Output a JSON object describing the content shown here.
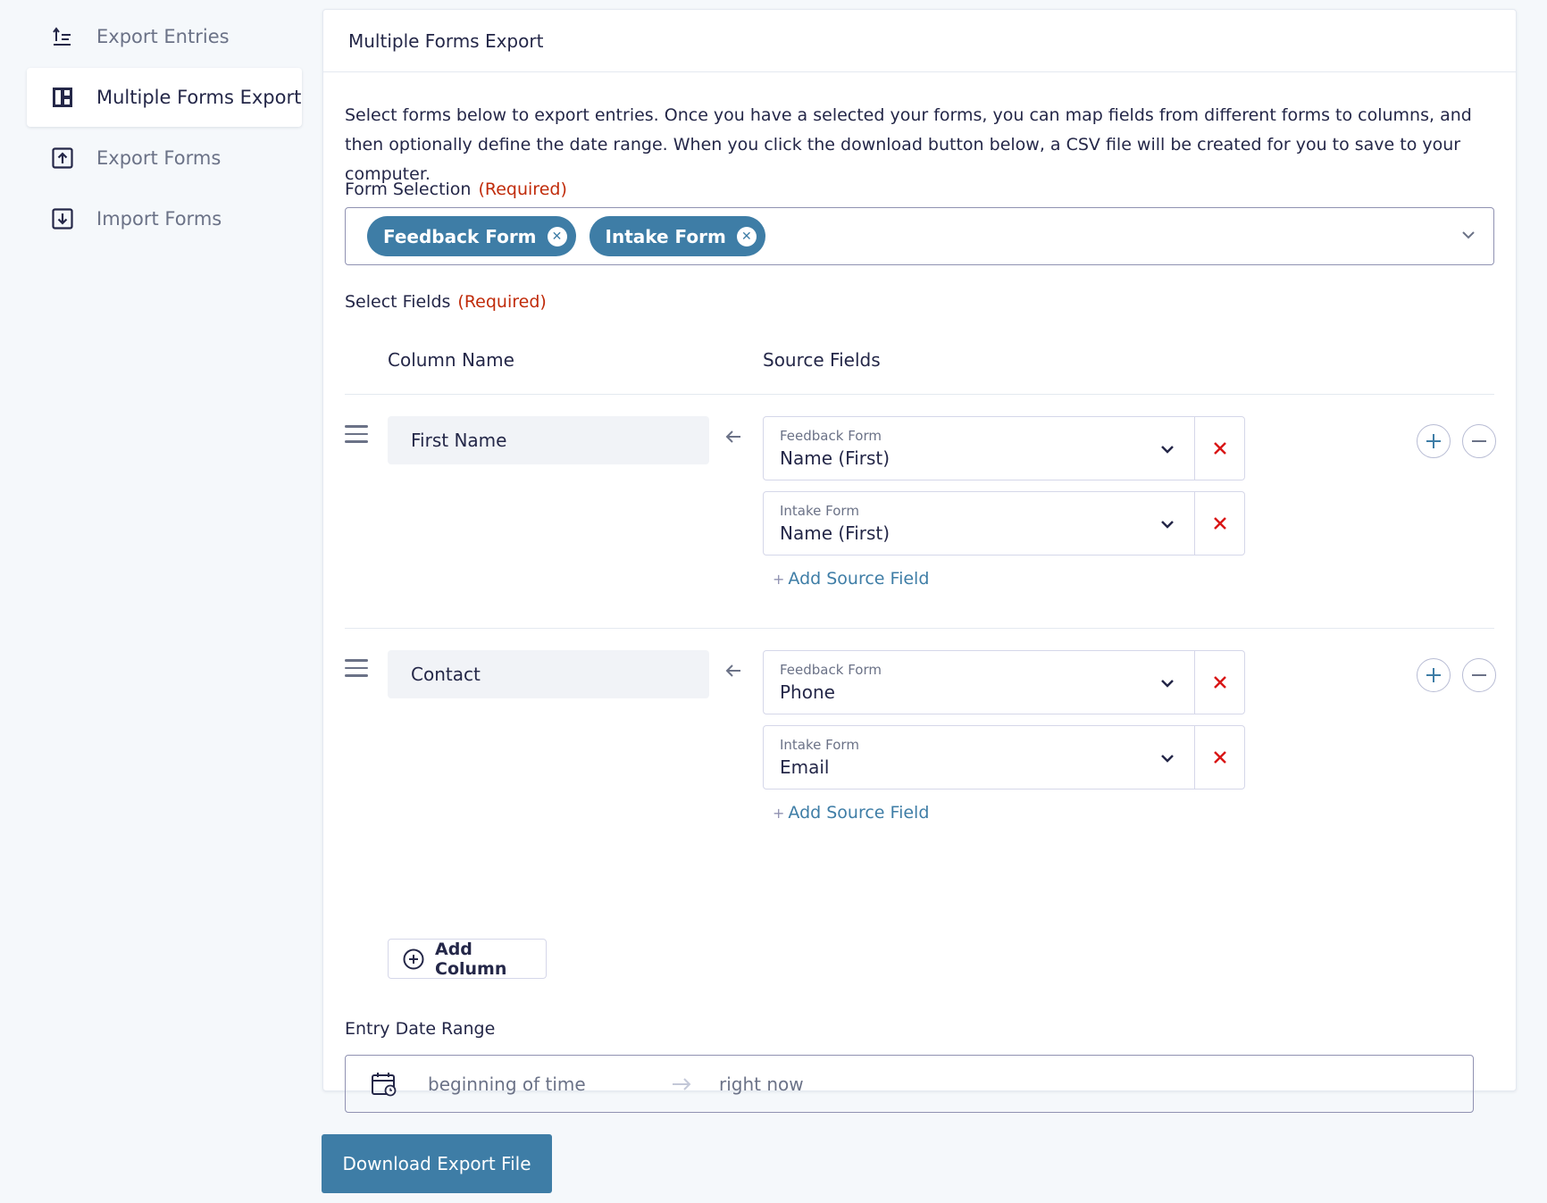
{
  "sidebar": {
    "items": [
      {
        "label": "Export Entries",
        "icon": "export-entries-icon",
        "active": false
      },
      {
        "label": "Multiple Forms Export",
        "icon": "multiple-forms-icon",
        "active": true
      },
      {
        "label": "Export Forms",
        "icon": "export-forms-icon",
        "active": false
      },
      {
        "label": "Import Forms",
        "icon": "import-forms-icon",
        "active": false
      }
    ]
  },
  "panel": {
    "title": "Multiple Forms Export",
    "description": "Select forms below to export entries. Once you have a selected your forms, you can map fields from different forms to columns, and then optionally define the date range. When you click the download button below, a CSV file will be created for you to save to your computer.",
    "form_selection": {
      "label": "Form Selection",
      "required": "(Required)",
      "chips": [
        "Feedback Form",
        "Intake Form"
      ]
    },
    "select_fields": {
      "label": "Select Fields",
      "required": "(Required)",
      "column_header": "Column Name",
      "source_header": "Source Fields",
      "add_source_label": "Add Source Field",
      "columns": [
        {
          "name": "First Name",
          "sources": [
            {
              "form": "Feedback Form",
              "field": "Name (First)"
            },
            {
              "form": "Intake Form",
              "field": "Name (First)"
            }
          ]
        },
        {
          "name": "Contact",
          "sources": [
            {
              "form": "Feedback Form",
              "field": "Phone"
            },
            {
              "form": "Intake Form",
              "field": "Email"
            }
          ]
        }
      ],
      "add_column_label": "Add Column"
    },
    "date_range": {
      "label": "Entry Date Range",
      "start_placeholder": "beginning of time",
      "end_placeholder": "right now"
    }
  },
  "download_button": "Download Export File",
  "colors": {
    "accent": "#3e7da6",
    "required": "#c02b0a",
    "delete": "#d91616"
  }
}
